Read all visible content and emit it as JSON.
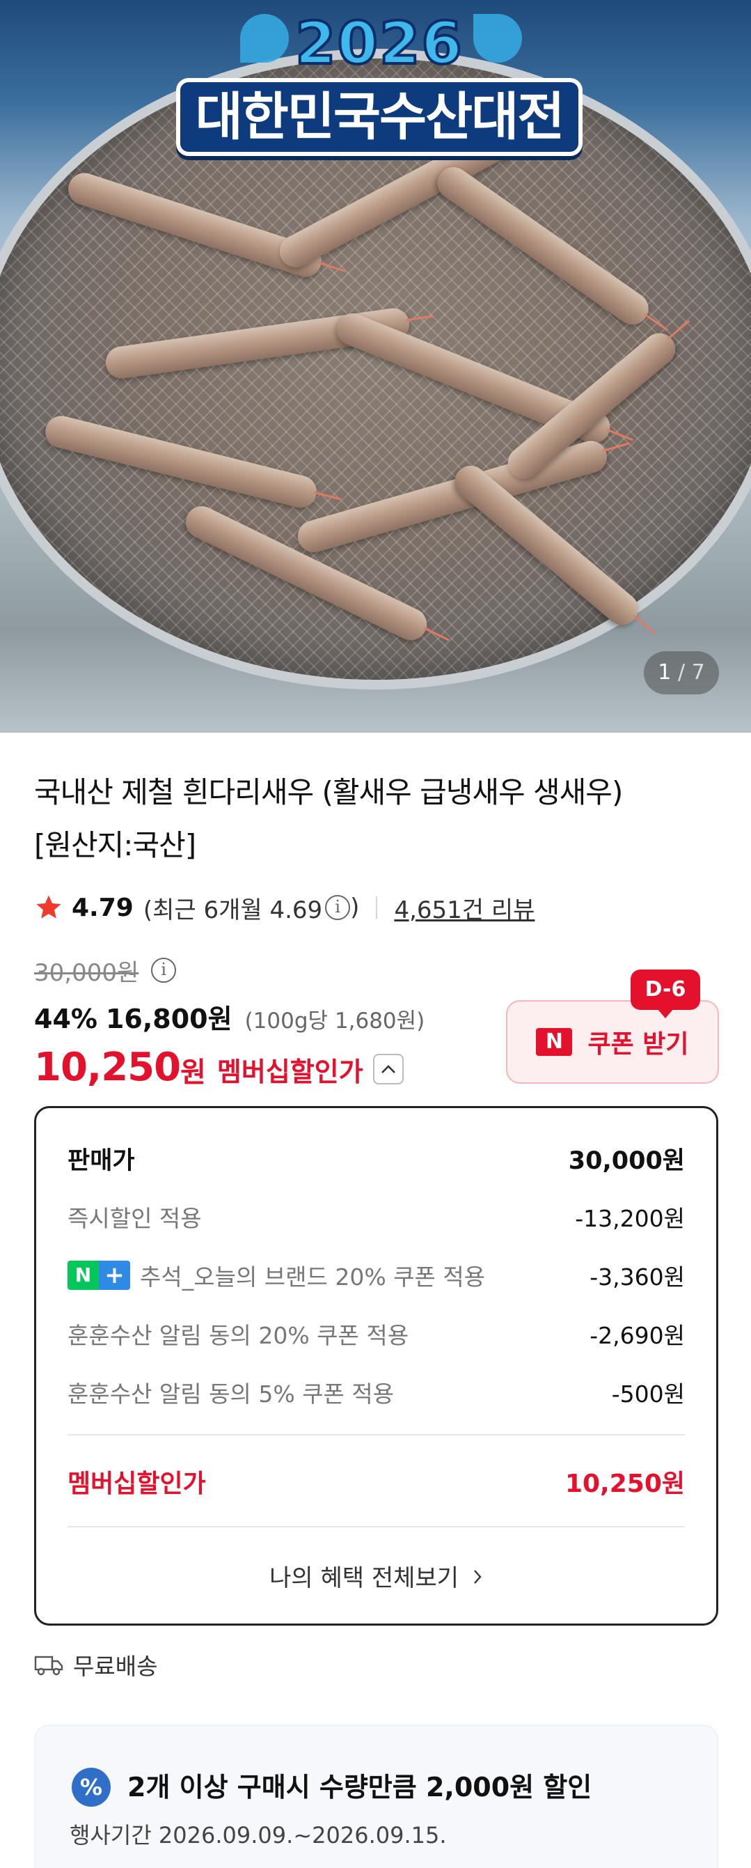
{
  "hero": {
    "banner_year": "2026",
    "banner_title": "대한민국수산대전",
    "counter_current": "1",
    "counter_total": "7"
  },
  "product": {
    "title_line1": "국내산 제철 흰다리새우 (활새우 급냉새우 생새우)",
    "title_line2": "[원산지:국산]"
  },
  "rating": {
    "score": "4.79",
    "recent_prefix": "(최근 6개월 4.69",
    "recent_suffix": ")",
    "review_count": "4,651건 리뷰"
  },
  "price": {
    "original": "30,000원",
    "discount_pct": "44%",
    "sale_price": "16,800원",
    "unit_price": "(100g당 1,680원)",
    "member_price": "10,250",
    "member_won": "원",
    "member_label": "멤버십할인가"
  },
  "coupon": {
    "dday": "D-6",
    "n_logo": "N",
    "label": "쿠폰 받기"
  },
  "breakdown": {
    "header_label": "판매가",
    "header_amount": "30,000원",
    "rows": [
      {
        "label": "즉시할인 적용",
        "amount": "-13,200원"
      },
      {
        "label": "추석_오늘의 브랜드 20% 쿠폰 적용",
        "amount": "-3,360원",
        "badge_n": "N",
        "badge_plus": "+"
      },
      {
        "label": "훈훈수산 알림 동의 20% 쿠폰 적용",
        "amount": "-2,690원"
      },
      {
        "label": "훈훈수산 알림 동의 5% 쿠폰 적용",
        "amount": "-500원"
      }
    ],
    "member_label": "멤버십할인가",
    "member_amount": "10,250원",
    "see_all": "나의 혜택 전체보기"
  },
  "shipping": {
    "label": "무료배송"
  },
  "promo": {
    "icon": "%",
    "title": "2개 이상 구매시 수량만큼 2,000원 할인",
    "period": "행사기간 2026.09.09.~2026.09.15."
  },
  "colors": {
    "accent_red": "#e4112d",
    "naver_green": "#03c75a",
    "plus_blue": "#2f8ae6",
    "star": "#ef3b2d"
  },
  "icons": [
    "star-icon",
    "info-icon",
    "chevron-up-icon",
    "chevron-right-icon",
    "truck-icon",
    "percent-icon",
    "naver-n-icon"
  ]
}
